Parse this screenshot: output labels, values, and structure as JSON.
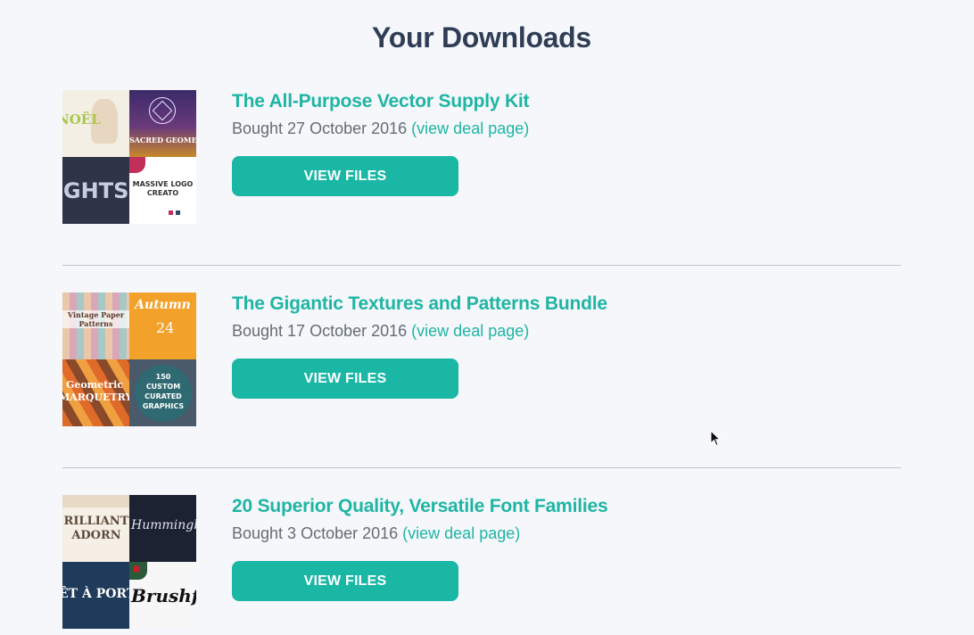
{
  "page": {
    "title": "Your Downloads"
  },
  "downloads": [
    {
      "title": "The All-Purpose Vector Supply Kit",
      "bought_text": "Bought 27 October 2016",
      "link_text": "(view deal page)",
      "button_label": "VIEW FILES",
      "thumbnail_tiles": [
        {
          "text": "NOËL",
          "bg": "#f3efe4",
          "fg": "#a8c84a"
        },
        {
          "text": "SACRED GEOMET",
          "bg": "#3b2a6a",
          "fg": "#ffffff"
        },
        {
          "text": "IGHTS",
          "bg": "#2f3448",
          "fg": "#c9cde0"
        },
        {
          "text": "MASSIVE LOGO CREATO",
          "bg": "#ffffff",
          "fg": "#333333"
        }
      ]
    },
    {
      "title": "The Gigantic Textures and Patterns Bundle",
      "bought_text": "Bought 17 October 2016",
      "link_text": "(view deal page)",
      "button_label": "VIEW FILES",
      "thumbnail_tiles": [
        {
          "text": "Vintage Paper Patterns",
          "bg": "#e9c7a8",
          "fg": "#5a3a2a"
        },
        {
          "text": "Autumn",
          "bg": "#f2a12b",
          "fg": "#ffffff"
        },
        {
          "text": "Geometric MARQUETRY",
          "bg": "#c9662a",
          "fg": "#ffffff"
        },
        {
          "text": "150 CUSTOM CURATED GRAPHICS",
          "bg": "#4a5a6a",
          "fg": "#ffffff"
        }
      ]
    },
    {
      "title": "20 Superior Quality, Versatile Font Families",
      "bought_text": "Bought 3 October 2016",
      "link_text": "(view deal page)",
      "button_label": "VIEW FILES",
      "thumbnail_tiles": [
        {
          "text": "RILLIANT ADORN",
          "bg": "#f6efe6",
          "fg": "#5a4a3a"
        },
        {
          "text": "Hummingbi",
          "bg": "#1d2233",
          "fg": "#e0e4ef"
        },
        {
          "text": "ÊT À PORTER",
          "bg": "#1f3a5a",
          "fg": "#ffffff"
        },
        {
          "text": "Brushfir",
          "bg": "#f7f7f7",
          "fg": "#111111"
        }
      ]
    }
  ]
}
